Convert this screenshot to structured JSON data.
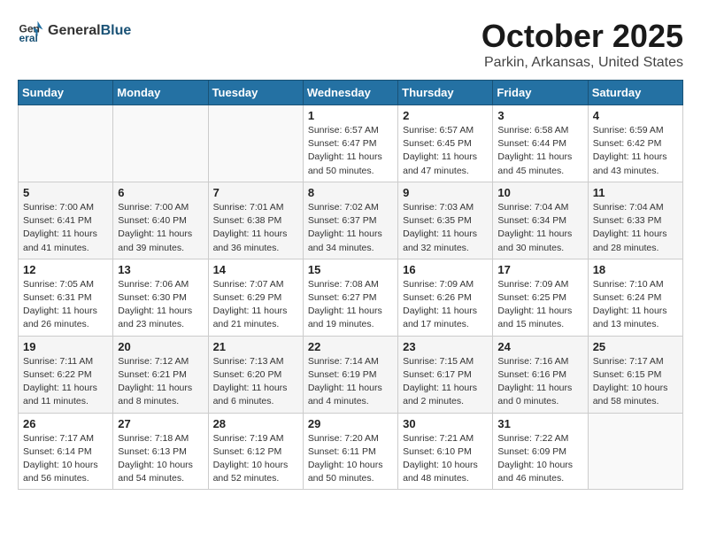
{
  "header": {
    "logo_general": "General",
    "logo_blue": "Blue",
    "month": "October 2025",
    "location": "Parkin, Arkansas, United States"
  },
  "weekdays": [
    "Sunday",
    "Monday",
    "Tuesday",
    "Wednesday",
    "Thursday",
    "Friday",
    "Saturday"
  ],
  "weeks": [
    [
      {
        "day": "",
        "info": ""
      },
      {
        "day": "",
        "info": ""
      },
      {
        "day": "",
        "info": ""
      },
      {
        "day": "1",
        "info": "Sunrise: 6:57 AM\nSunset: 6:47 PM\nDaylight: 11 hours\nand 50 minutes."
      },
      {
        "day": "2",
        "info": "Sunrise: 6:57 AM\nSunset: 6:45 PM\nDaylight: 11 hours\nand 47 minutes."
      },
      {
        "day": "3",
        "info": "Sunrise: 6:58 AM\nSunset: 6:44 PM\nDaylight: 11 hours\nand 45 minutes."
      },
      {
        "day": "4",
        "info": "Sunrise: 6:59 AM\nSunset: 6:42 PM\nDaylight: 11 hours\nand 43 minutes."
      }
    ],
    [
      {
        "day": "5",
        "info": "Sunrise: 7:00 AM\nSunset: 6:41 PM\nDaylight: 11 hours\nand 41 minutes."
      },
      {
        "day": "6",
        "info": "Sunrise: 7:00 AM\nSunset: 6:40 PM\nDaylight: 11 hours\nand 39 minutes."
      },
      {
        "day": "7",
        "info": "Sunrise: 7:01 AM\nSunset: 6:38 PM\nDaylight: 11 hours\nand 36 minutes."
      },
      {
        "day": "8",
        "info": "Sunrise: 7:02 AM\nSunset: 6:37 PM\nDaylight: 11 hours\nand 34 minutes."
      },
      {
        "day": "9",
        "info": "Sunrise: 7:03 AM\nSunset: 6:35 PM\nDaylight: 11 hours\nand 32 minutes."
      },
      {
        "day": "10",
        "info": "Sunrise: 7:04 AM\nSunset: 6:34 PM\nDaylight: 11 hours\nand 30 minutes."
      },
      {
        "day": "11",
        "info": "Sunrise: 7:04 AM\nSunset: 6:33 PM\nDaylight: 11 hours\nand 28 minutes."
      }
    ],
    [
      {
        "day": "12",
        "info": "Sunrise: 7:05 AM\nSunset: 6:31 PM\nDaylight: 11 hours\nand 26 minutes."
      },
      {
        "day": "13",
        "info": "Sunrise: 7:06 AM\nSunset: 6:30 PM\nDaylight: 11 hours\nand 23 minutes."
      },
      {
        "day": "14",
        "info": "Sunrise: 7:07 AM\nSunset: 6:29 PM\nDaylight: 11 hours\nand 21 minutes."
      },
      {
        "day": "15",
        "info": "Sunrise: 7:08 AM\nSunset: 6:27 PM\nDaylight: 11 hours\nand 19 minutes."
      },
      {
        "day": "16",
        "info": "Sunrise: 7:09 AM\nSunset: 6:26 PM\nDaylight: 11 hours\nand 17 minutes."
      },
      {
        "day": "17",
        "info": "Sunrise: 7:09 AM\nSunset: 6:25 PM\nDaylight: 11 hours\nand 15 minutes."
      },
      {
        "day": "18",
        "info": "Sunrise: 7:10 AM\nSunset: 6:24 PM\nDaylight: 11 hours\nand 13 minutes."
      }
    ],
    [
      {
        "day": "19",
        "info": "Sunrise: 7:11 AM\nSunset: 6:22 PM\nDaylight: 11 hours\nand 11 minutes."
      },
      {
        "day": "20",
        "info": "Sunrise: 7:12 AM\nSunset: 6:21 PM\nDaylight: 11 hours\nand 8 minutes."
      },
      {
        "day": "21",
        "info": "Sunrise: 7:13 AM\nSunset: 6:20 PM\nDaylight: 11 hours\nand 6 minutes."
      },
      {
        "day": "22",
        "info": "Sunrise: 7:14 AM\nSunset: 6:19 PM\nDaylight: 11 hours\nand 4 minutes."
      },
      {
        "day": "23",
        "info": "Sunrise: 7:15 AM\nSunset: 6:17 PM\nDaylight: 11 hours\nand 2 minutes."
      },
      {
        "day": "24",
        "info": "Sunrise: 7:16 AM\nSunset: 6:16 PM\nDaylight: 11 hours\nand 0 minutes."
      },
      {
        "day": "25",
        "info": "Sunrise: 7:17 AM\nSunset: 6:15 PM\nDaylight: 10 hours\nand 58 minutes."
      }
    ],
    [
      {
        "day": "26",
        "info": "Sunrise: 7:17 AM\nSunset: 6:14 PM\nDaylight: 10 hours\nand 56 minutes."
      },
      {
        "day": "27",
        "info": "Sunrise: 7:18 AM\nSunset: 6:13 PM\nDaylight: 10 hours\nand 54 minutes."
      },
      {
        "day": "28",
        "info": "Sunrise: 7:19 AM\nSunset: 6:12 PM\nDaylight: 10 hours\nand 52 minutes."
      },
      {
        "day": "29",
        "info": "Sunrise: 7:20 AM\nSunset: 6:11 PM\nDaylight: 10 hours\nand 50 minutes."
      },
      {
        "day": "30",
        "info": "Sunrise: 7:21 AM\nSunset: 6:10 PM\nDaylight: 10 hours\nand 48 minutes."
      },
      {
        "day": "31",
        "info": "Sunrise: 7:22 AM\nSunset: 6:09 PM\nDaylight: 10 hours\nand 46 minutes."
      },
      {
        "day": "",
        "info": ""
      }
    ]
  ]
}
